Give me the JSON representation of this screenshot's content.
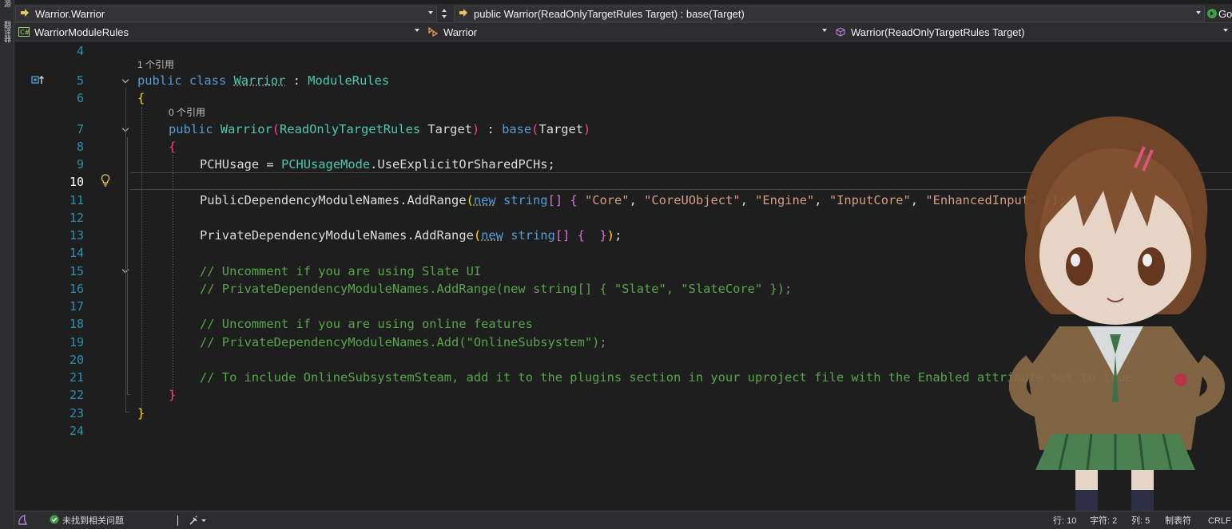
{
  "left_strip": {
    "tab1": "源",
    "tab2": "翻译器"
  },
  "nav1": {
    "project_combo": "Warrior.Warrior",
    "member_combo": "public Warrior(ReadOnlyTargetRules Target) : base(Target)",
    "go_label": "Go"
  },
  "nav2": {
    "file_combo": "WarriorModuleRules",
    "class_combo": "Warrior",
    "member_combo": "Warrior(ReadOnlyTargetRules Target)"
  },
  "editor": {
    "codelens": [
      "1 个引用",
      "0 个引用"
    ],
    "current_line": 10,
    "lines": [
      {
        "n": "4"
      },
      {
        "n": "5"
      },
      {
        "n": "6"
      },
      {
        "n": "7"
      },
      {
        "n": "8"
      },
      {
        "n": "9"
      },
      {
        "n": "10"
      },
      {
        "n": "11"
      },
      {
        "n": "12"
      },
      {
        "n": "13"
      },
      {
        "n": "14"
      },
      {
        "n": "15"
      },
      {
        "n": "16"
      },
      {
        "n": "17"
      },
      {
        "n": "18"
      },
      {
        "n": "19"
      },
      {
        "n": "20"
      },
      {
        "n": "21"
      },
      {
        "n": "22"
      },
      {
        "n": "23"
      },
      {
        "n": "24"
      }
    ],
    "code": {
      "l5_kw1": "public",
      "l5_kw2": "class",
      "l5_name": "Warrior",
      "l5_colon": " : ",
      "l5_base": "ModuleRules",
      "l6": "{",
      "l7_kw": "public",
      "l7_name": "Warrior",
      "l7_p1": "(",
      "l7_type": "ReadOnlyTargetRules",
      "l7_arg": " Target",
      "l7_p2": ")",
      "l7_colon": " : ",
      "l7_base": "base",
      "l7_p3": "(",
      "l7_arg2": "Target",
      "l7_p4": ")",
      "l8": "{",
      "l9_prop": "PCHUsage",
      "l9_eq": " = ",
      "l9_type": "PCHUsageMode",
      "l9_rest": ".UseExplicitOrSharedPCHs;",
      "l11_prop": "PublicDependencyModuleNames",
      "l11_call": ".AddRange",
      "l11_p1": "(",
      "l11_new": "new",
      "l11_string": "string",
      "l11_br": "[]",
      "l11_cb1": "{",
      "l11_s1": "\"Core\"",
      "l11_s2": "\"CoreUObject\"",
      "l11_s3": "\"Engine\"",
      "l11_s4": "\"InputCore\"",
      "l11_s5": "\"EnhancedInput\"",
      "l11_cb2": "}",
      "l11_p2": ")",
      "l11_end": ";",
      "l13_prop": "PrivateDependencyModuleNames",
      "l13_call": ".AddRange",
      "l13_p1": "(",
      "l13_new": "new",
      "l13_string": "string",
      "l13_br": "[]",
      "l13_cb1": "{",
      "l13_cb2": "}",
      "l13_p2": ")",
      "l13_end": ";",
      "l15": "// Uncomment if you are using Slate UI",
      "l16": "// PrivateDependencyModuleNames.AddRange(new string[] { \"Slate\", \"SlateCore\" });",
      "l18": "// Uncomment if you are using online features",
      "l19": "// PrivateDependencyModuleNames.Add(\"OnlineSubsystem\");",
      "l21": "// To include OnlineSubsystemSteam, add it to the plugins section in your uproject file with the Enabled attribute set to true",
      "l22": "}",
      "l23": "}"
    }
  },
  "statusbar": {
    "issues": "未找到相关问题",
    "line": "行: 10",
    "char": "字符: 2",
    "col": "列: 5",
    "tabs": "制表符",
    "eol": "CRLF"
  },
  "colors": {
    "keyword": "#569cd6",
    "type": "#4ec9b0",
    "string": "#d69d85",
    "comment": "#57a64a",
    "line_number": "#2b91af",
    "background": "#1e1e1e"
  }
}
